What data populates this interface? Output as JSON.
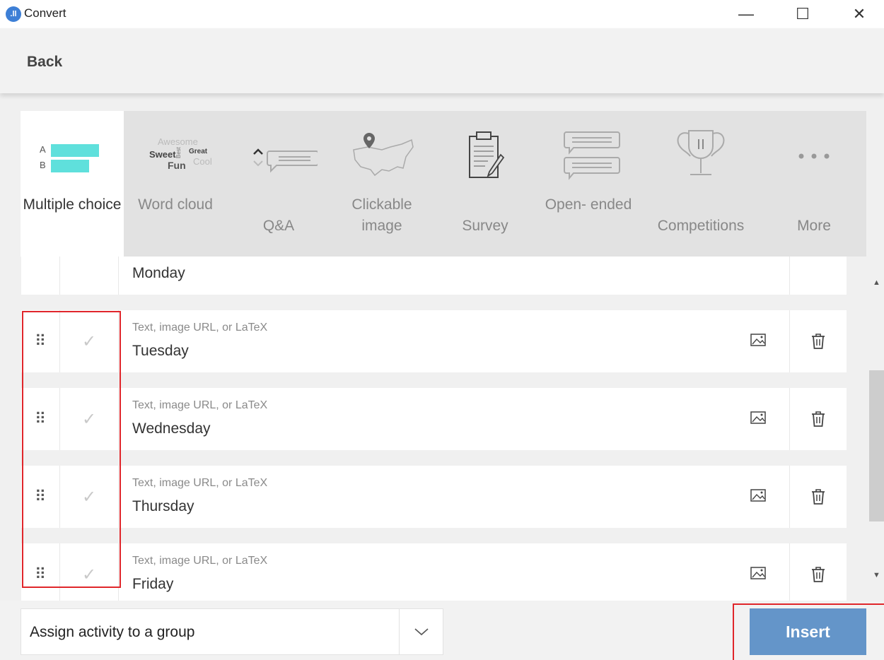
{
  "window": {
    "title": "Convert",
    "logo_text": ".ll",
    "minimize_glyph": "—",
    "maximize_glyph": "☐",
    "close_glyph": "✕"
  },
  "toolbar": {
    "back_label": "Back"
  },
  "activity_types": [
    {
      "label": "Multiple choice",
      "icon": "multiple-choice-icon",
      "active": true
    },
    {
      "label": "Word cloud",
      "icon": "word-cloud-icon",
      "active": false,
      "icon_words": [
        "Awesome",
        "Sweet",
        "Best",
        "Great",
        "Fun",
        "Cool"
      ]
    },
    {
      "label": "Q&A",
      "icon": "qa-icon",
      "active": false
    },
    {
      "label": "Clickable image",
      "icon": "map-pin-icon",
      "active": false
    },
    {
      "label": "Survey",
      "icon": "clipboard-icon",
      "active": false
    },
    {
      "label": "Open- ended",
      "icon": "open-ended-icon",
      "active": false
    },
    {
      "label": "Competitions",
      "icon": "trophy-icon",
      "active": false
    },
    {
      "label": "More",
      "icon": "more-icon",
      "active": false
    }
  ],
  "multiple_choice_icon_letters": [
    "A",
    "B"
  ],
  "options": [
    {
      "placeholder": "Text, image URL, or LaTeX",
      "value": "Monday"
    },
    {
      "placeholder": "Text, image URL, or LaTeX",
      "value": "Tuesday"
    },
    {
      "placeholder": "Text, image URL, or LaTeX",
      "value": "Wednesday"
    },
    {
      "placeholder": "Text, image URL, or LaTeX",
      "value": "Thursday"
    },
    {
      "placeholder": "Text, image URL, or LaTeX",
      "value": "Friday"
    }
  ],
  "icons": {
    "drag": "⠿",
    "check": "✓"
  },
  "footer": {
    "group_label": "Assign activity to a group",
    "insert_label": "Insert"
  },
  "colors": {
    "accent_teal": "#5fe0dc",
    "insert_blue": "#6495c9",
    "highlight_red": "#e0262b"
  }
}
